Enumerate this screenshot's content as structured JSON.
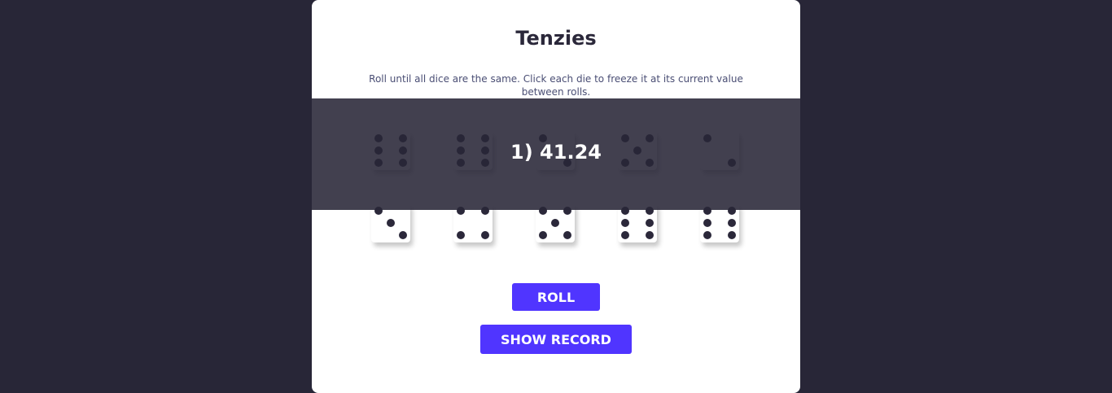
{
  "game": {
    "title": "Tenzies",
    "instructions": "Roll until all dice are the same. Click each die to freeze it at its current value between rolls.",
    "dice": [
      {
        "value": 6,
        "held": false
      },
      {
        "value": 6,
        "held": false
      },
      {
        "value": 2,
        "held": false
      },
      {
        "value": 5,
        "held": false
      },
      {
        "value": 2,
        "held": false
      },
      {
        "value": 3,
        "held": false
      },
      {
        "value": 4,
        "held": false
      },
      {
        "value": 5,
        "held": false
      },
      {
        "value": 6,
        "held": false
      },
      {
        "value": 6,
        "held": false
      }
    ]
  },
  "record_overlay": {
    "text": "1) 41.24"
  },
  "buttons": {
    "roll_label": "ROLL",
    "show_record_label": "SHOW RECORD"
  },
  "colors": {
    "background": "#282637",
    "card": "#ffffff",
    "pip": "#2b283a",
    "button": "#5035ff",
    "overlay": "#282637"
  }
}
